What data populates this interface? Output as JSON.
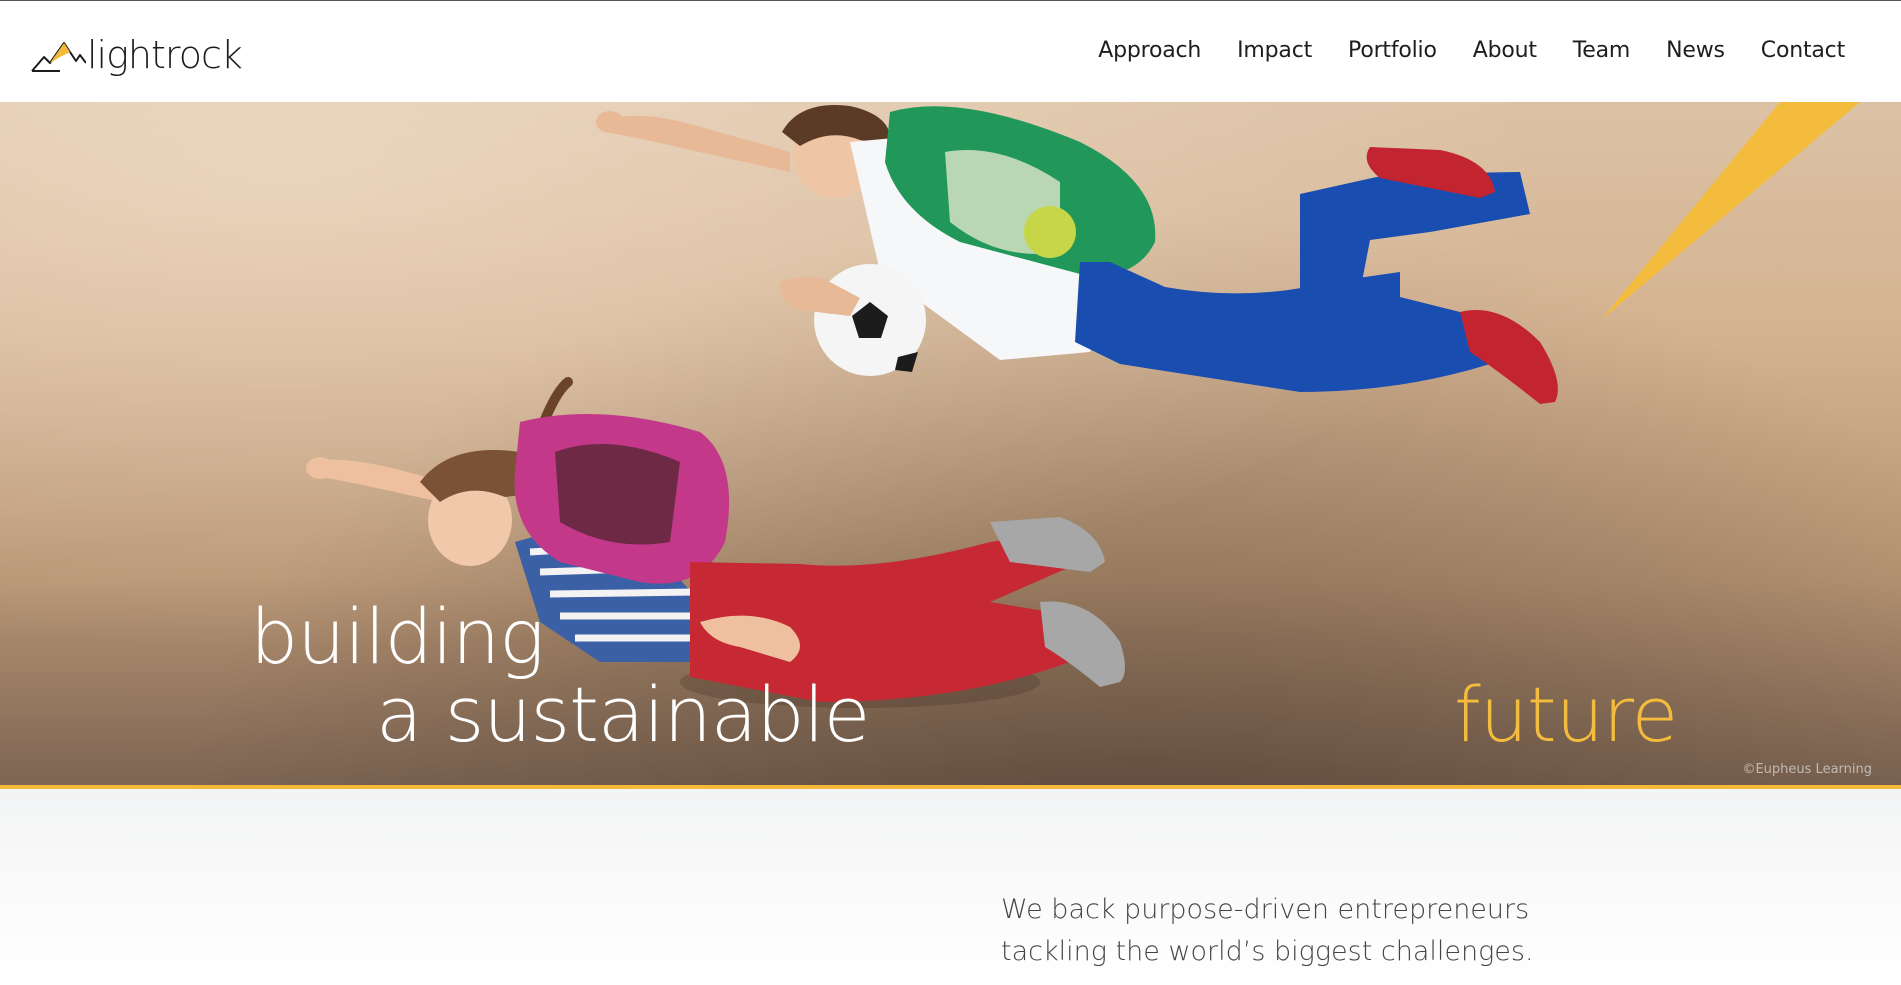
{
  "site": {
    "logo_text": "lightrock"
  },
  "nav": {
    "items": [
      {
        "label": "Approach"
      },
      {
        "label": "Impact"
      },
      {
        "label": "Portfolio"
      },
      {
        "label": "About"
      },
      {
        "label": "Team"
      },
      {
        "label": "News"
      },
      {
        "label": "Contact"
      }
    ]
  },
  "hero": {
    "line1": "building",
    "line2": "a sustainable",
    "line3": "future",
    "credit": "©Eupheus Learning",
    "accent_color": "#f4b93a"
  },
  "intro": {
    "text": "We back purpose-driven entrepreneurs tackling the world’s biggest challenges."
  },
  "icons": {
    "logo": "mountain-logo-icon"
  }
}
